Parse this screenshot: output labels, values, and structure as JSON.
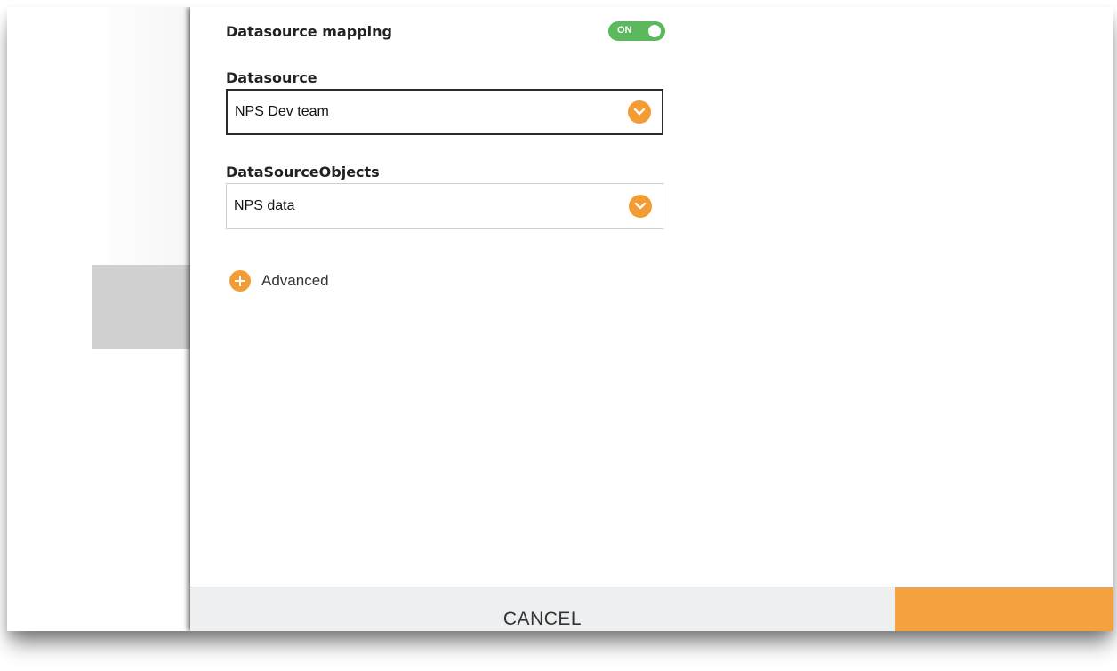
{
  "mapping": {
    "label": "Datasource mapping",
    "toggle": {
      "state_text": "ON",
      "color": "#5cb85c"
    }
  },
  "datasource": {
    "label": "Datasource",
    "selected": "NPS Dev team"
  },
  "datasource_objects": {
    "label": "DataSourceObjects",
    "selected": "NPS data"
  },
  "advanced": {
    "label": "Advanced"
  },
  "footer": {
    "cancel_label": "CANCEL",
    "accent": "#f4a140"
  },
  "icons": {
    "dropdown": "chevron-down-icon",
    "advanced": "plus-circle-icon"
  }
}
